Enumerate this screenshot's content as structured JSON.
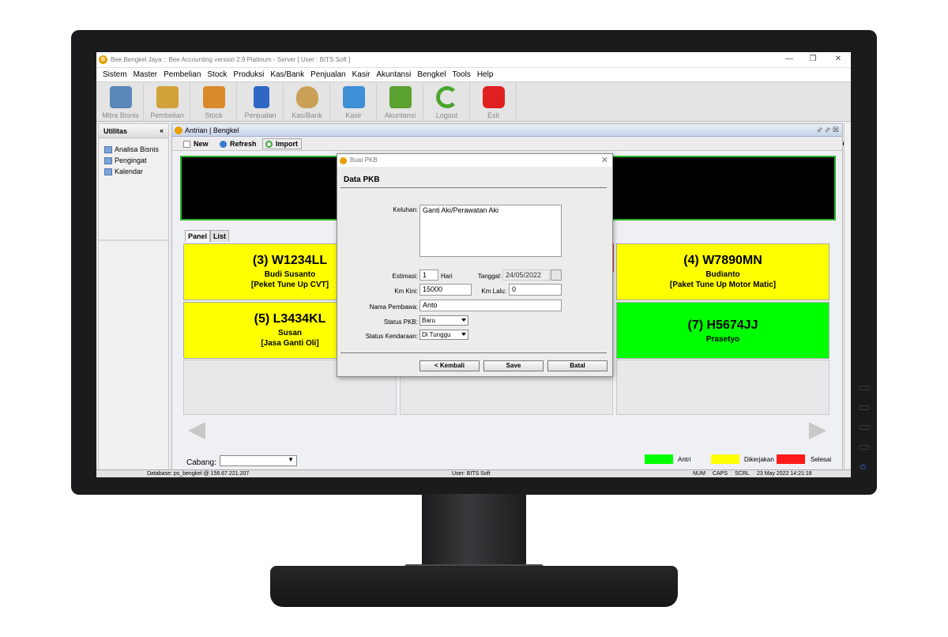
{
  "window": {
    "title": "Bee.Bengkel Jaya :: Bee Accounting version 2.9 Platinum - Server  [ User : BITS Soft ]",
    "controls": [
      "—",
      "❐",
      "✕"
    ]
  },
  "menu": [
    "Sistem",
    "Master",
    "Pembelian",
    "Stock",
    "Produksi",
    "Kas/Bank",
    "Penjualan",
    "Kasir",
    "Akuntansi",
    "Bengkel",
    "Tools",
    "Help"
  ],
  "toolbar": {
    "items": [
      {
        "label": "Mitra Bisnis",
        "icon": "people-icon",
        "color": "#5b86b8"
      },
      {
        "label": "Pembelian",
        "icon": "invoice-icon",
        "color": "#d2a23a"
      },
      {
        "label": "Stock",
        "icon": "boxes-icon",
        "color": "#d98a2b"
      },
      {
        "label": "Penjualan",
        "icon": "shopping-bag-icon",
        "color": "#2f68c4"
      },
      {
        "label": "Kas/Bank",
        "icon": "money-bag-icon",
        "color": "#caa056"
      },
      {
        "label": "Kasir",
        "icon": "cart-icon",
        "color": "#3d8fd6"
      },
      {
        "label": "Akuntansi",
        "icon": "chart-up-icon",
        "color": "#5aa12f"
      },
      {
        "label": "Logout",
        "icon": "logout-icon",
        "color": "#4aa62f"
      },
      {
        "label": "Exit",
        "icon": "power-icon",
        "color": "#e02020"
      }
    ],
    "nav_left": "<",
    "nav_right": ">",
    "nav_v": "V"
  },
  "sidebar": {
    "title": "Utilitas",
    "collapse": "«",
    "items": [
      "Analisa Bisnis",
      "Pengingat",
      "Kalendar"
    ]
  },
  "panel": {
    "title": "Antrian | Bengkel",
    "controls": "⬃ ⬀ ☒",
    "buttons": {
      "new": "New",
      "refresh": "Refresh",
      "import": "Import"
    },
    "tabs": [
      "Panel",
      "List"
    ],
    "cards": [
      {
        "plate": "(3) W1234LL",
        "name": "Budi Susanto",
        "service": "[Peket Tune Up CVT]",
        "color": "#ffff00"
      },
      {
        "plate": "(4) W7890MN",
        "name": "Budianto",
        "service": "[Paket Tune Up Motor Matic]",
        "color": "#ffff00"
      },
      {
        "plate": "(5) L3434KL",
        "name": "Susan",
        "service": "[Jasa Ganti Oli]",
        "color": "#ffff00"
      },
      {
        "plate": "(7) H5674JJ",
        "name": "Prasetyo",
        "service": "",
        "color": "#00ff00"
      }
    ],
    "cabang_label": "Cabang:",
    "cabang_value": "",
    "legend": [
      {
        "label": "Antri",
        "color": "#00ff00"
      },
      {
        "label": "Dikerjakan",
        "color": "#ffff00"
      },
      {
        "label": "Selesai",
        "color": "#ff1a1a"
      }
    ]
  },
  "statusbar": {
    "database": "Database: ps_bengkel @ 156.67.221.207",
    "user": "User: BITS Soft",
    "num": "NUM",
    "caps": "CAPS",
    "scrl": "SCRL",
    "datetime": "23 May 2022  14:21:18"
  },
  "dialog": {
    "title": "Buat PKB",
    "close": "✕",
    "section": "Data PKB",
    "fields": {
      "keluhan_label": "Keluhan:",
      "keluhan_value": "Ganti Aki/Perawatan Aki",
      "estimasi_label": "Estimasi:",
      "estimasi_value": "1",
      "estimasi_unit": "Hari",
      "tanggal_label": "Tanggal:",
      "tanggal_value": "24/05/2022",
      "km_kini_label": "Km Kini:",
      "km_kini_value": "15000",
      "km_lalu_label": "Km Lalu:",
      "km_lalu_value": "0",
      "pembawa_label": "Nama Pembawa:",
      "pembawa_value": "Anto",
      "status_pkb_label": "Status PKB:",
      "status_pkb_value": "Baru",
      "status_kendaraan_label": "Status Kendaraan:",
      "status_kendaraan_value": "Di Tunggu"
    },
    "buttons": {
      "back": "< Kembali",
      "save": "Save",
      "cancel": "Batal"
    }
  }
}
